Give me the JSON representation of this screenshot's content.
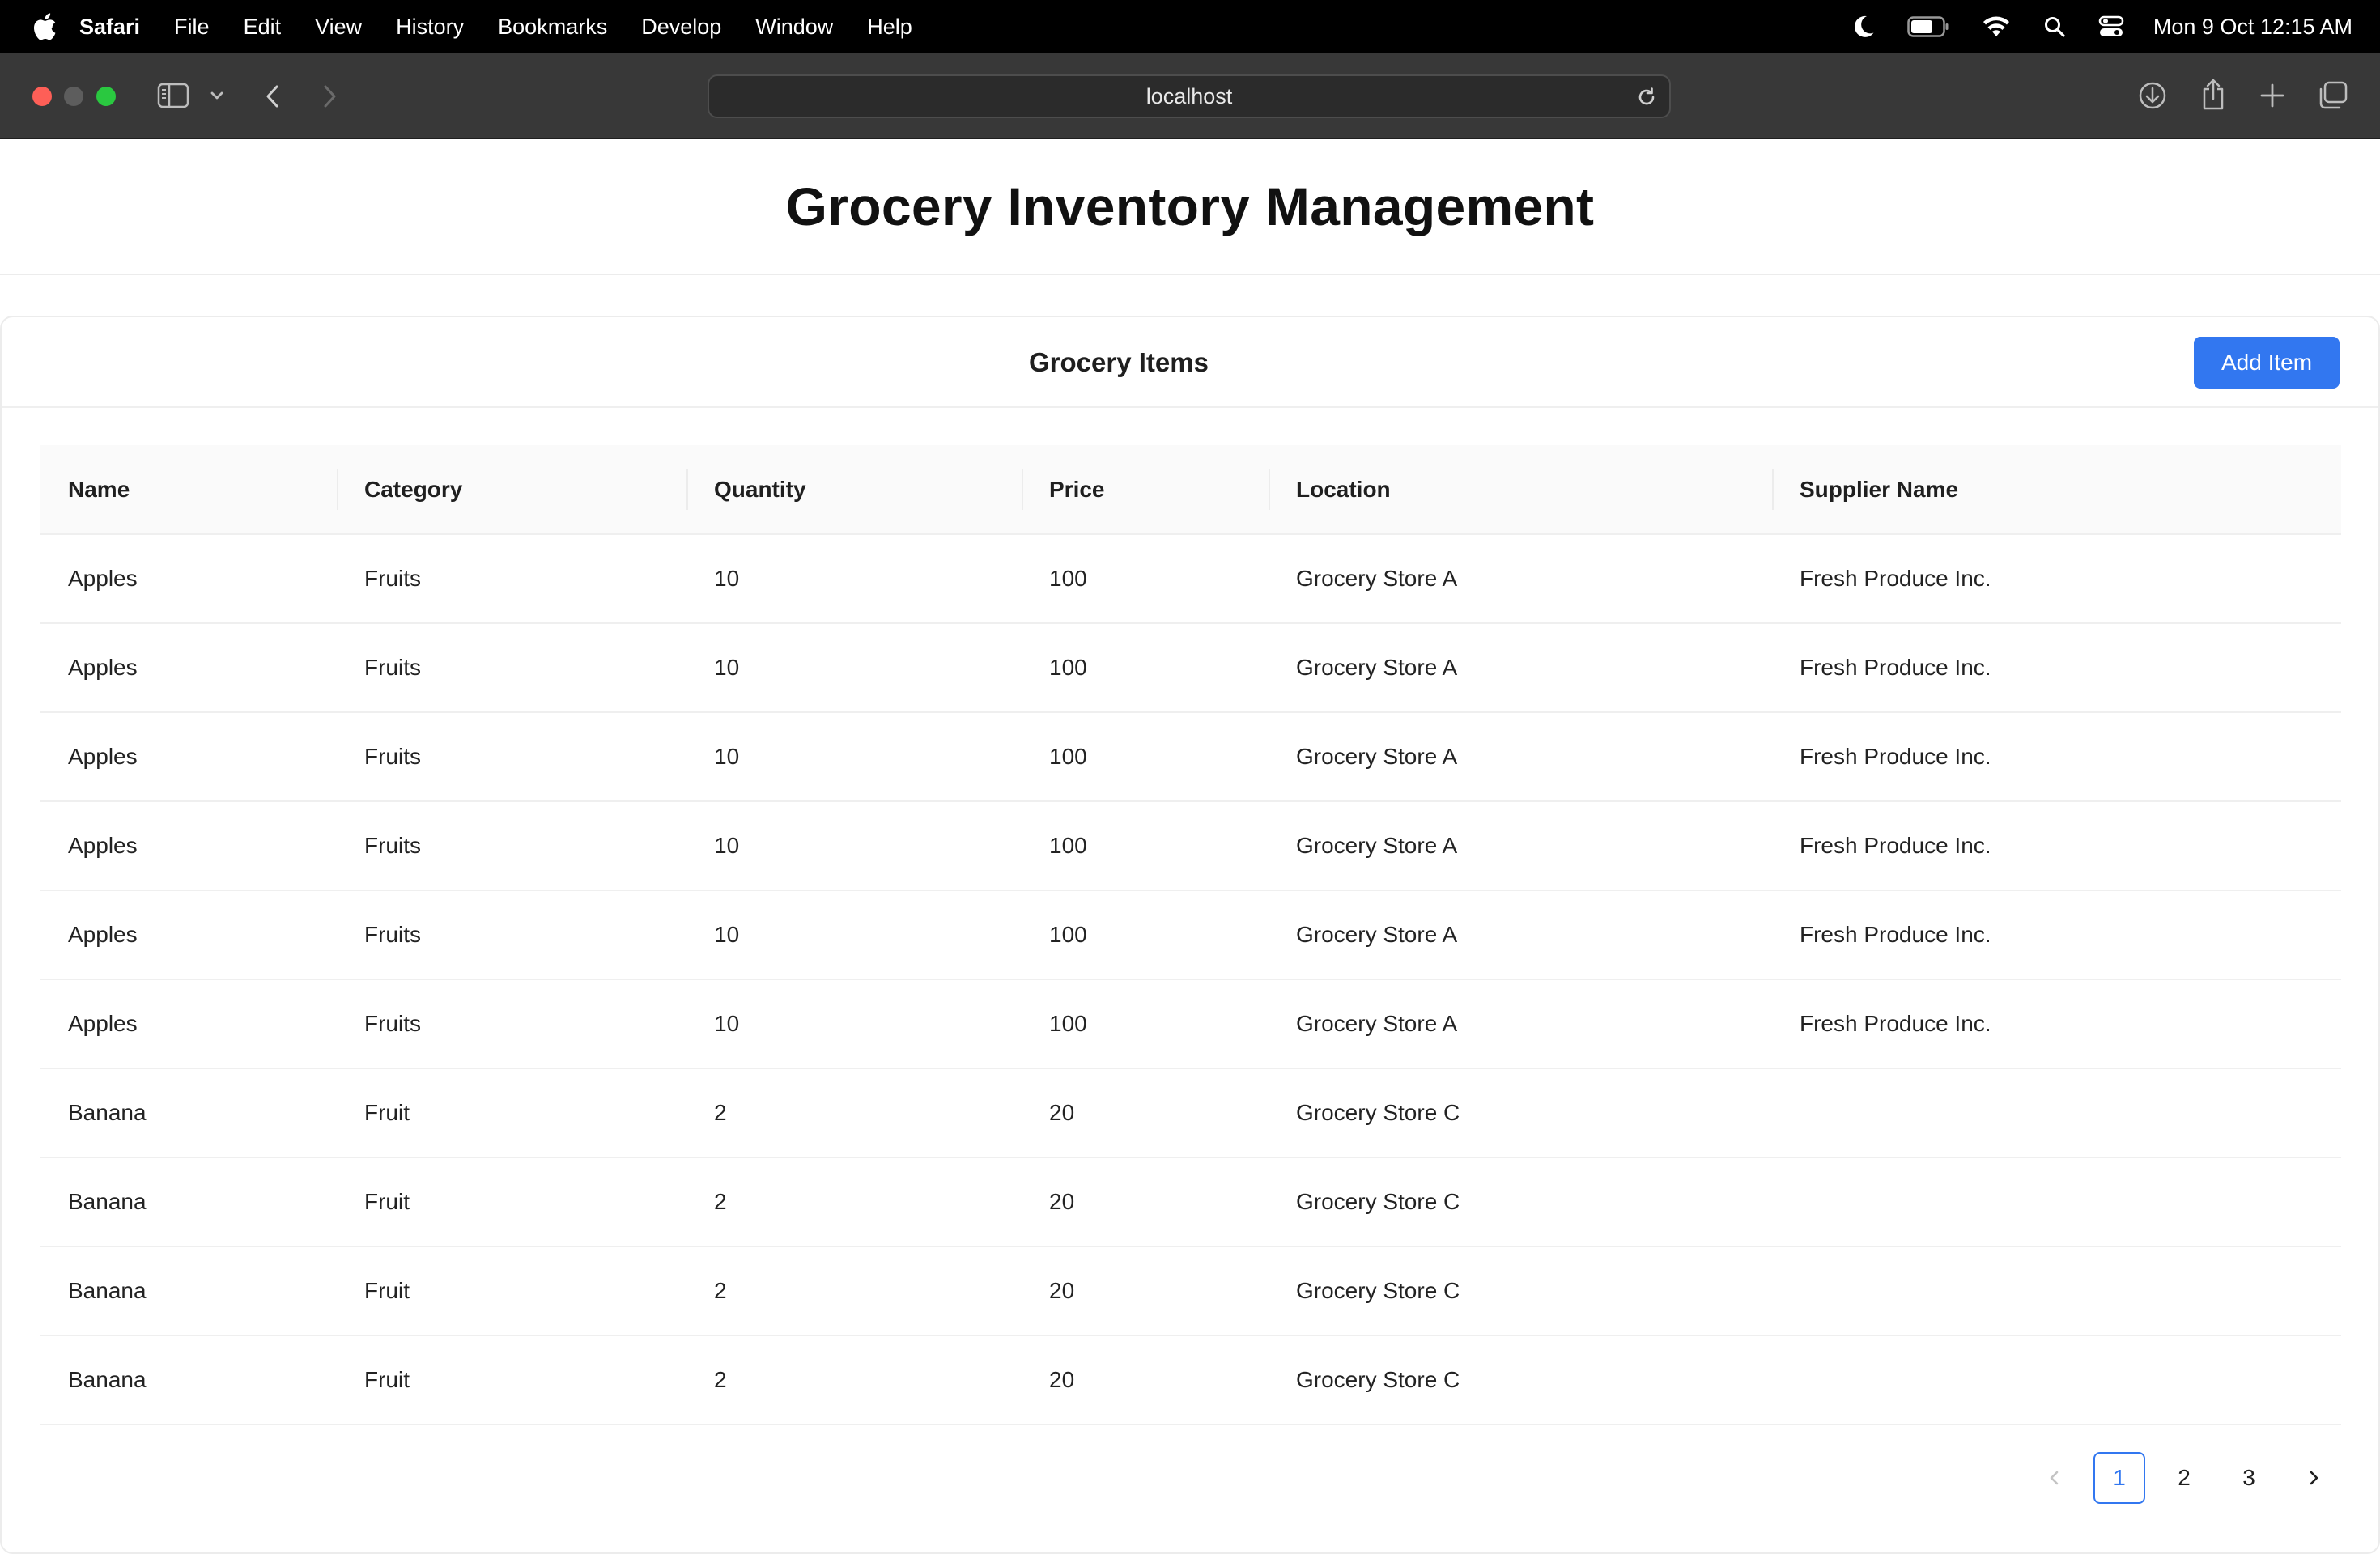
{
  "menubar": {
    "app_name": "Safari",
    "items": [
      "File",
      "Edit",
      "View",
      "History",
      "Bookmarks",
      "Develop",
      "Window",
      "Help"
    ],
    "clock": "Mon 9 Oct  12:15 AM",
    "status_icons": [
      "moon-icon",
      "battery-icon",
      "wifi-icon",
      "spotlight-search-icon",
      "control-center-icon"
    ]
  },
  "browser": {
    "url": "localhost"
  },
  "page": {
    "title": "Grocery Inventory Management"
  },
  "card": {
    "title": "Grocery Items",
    "add_button_label": "Add Item"
  },
  "table": {
    "columns": [
      "Name",
      "Category",
      "Quantity",
      "Price",
      "Location",
      "Supplier Name"
    ],
    "rows": [
      [
        "Apples",
        "Fruits",
        "10",
        "100",
        "Grocery Store A",
        "Fresh Produce Inc."
      ],
      [
        "Apples",
        "Fruits",
        "10",
        "100",
        "Grocery Store A",
        "Fresh Produce Inc."
      ],
      [
        "Apples",
        "Fruits",
        "10",
        "100",
        "Grocery Store A",
        "Fresh Produce Inc."
      ],
      [
        "Apples",
        "Fruits",
        "10",
        "100",
        "Grocery Store A",
        "Fresh Produce Inc."
      ],
      [
        "Apples",
        "Fruits",
        "10",
        "100",
        "Grocery Store A",
        "Fresh Produce Inc."
      ],
      [
        "Apples",
        "Fruits",
        "10",
        "100",
        "Grocery Store A",
        "Fresh Produce Inc."
      ],
      [
        "Banana",
        "Fruit",
        "2",
        "20",
        "Grocery Store C",
        ""
      ],
      [
        "Banana",
        "Fruit",
        "2",
        "20",
        "Grocery Store C",
        ""
      ],
      [
        "Banana",
        "Fruit",
        "2",
        "20",
        "Grocery Store C",
        ""
      ],
      [
        "Banana",
        "Fruit",
        "2",
        "20",
        "Grocery Store C",
        ""
      ]
    ]
  },
  "pagination": {
    "pages": [
      "1",
      "2",
      "3"
    ],
    "current": "1"
  },
  "colors": {
    "accent": "#3277f0",
    "menubar": "#000000",
    "toolbar": "#383838"
  }
}
